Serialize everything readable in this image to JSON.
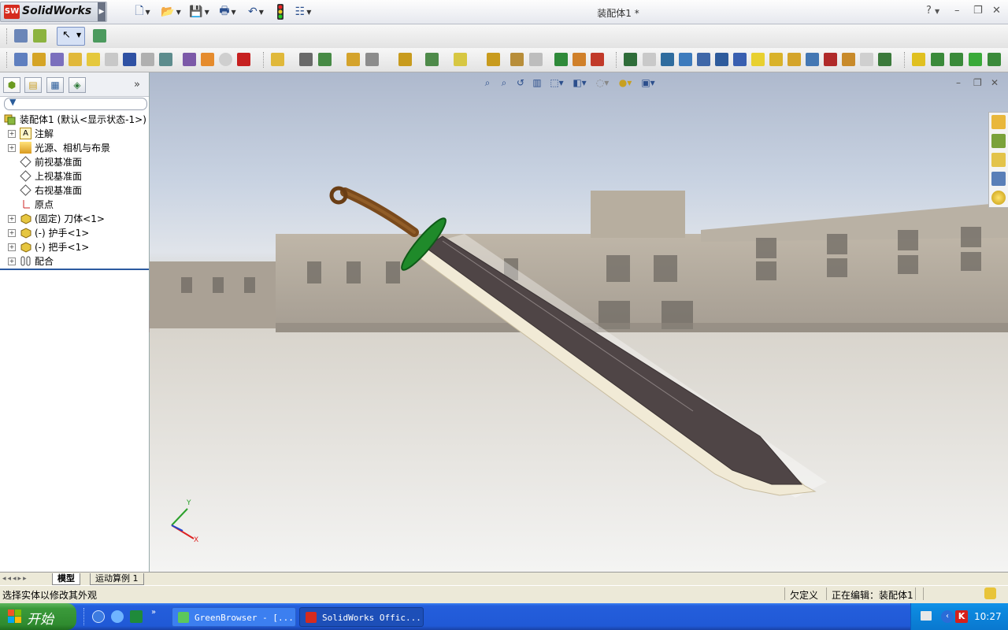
{
  "app": {
    "logo_text": "SolidWorks",
    "doc_title": "装配体1 *",
    "help_label": "?"
  },
  "tree": {
    "root": "装配体1 (默认<显示状态-1>)",
    "items": [
      {
        "label": "注解",
        "expand": "+"
      },
      {
        "label": "光源、相机与布景",
        "expand": "+"
      },
      {
        "label": "前视基准面",
        "expand": ""
      },
      {
        "label": "上视基准面",
        "expand": ""
      },
      {
        "label": "右视基准面",
        "expand": ""
      },
      {
        "label": "原点",
        "expand": ""
      },
      {
        "label": "(固定) 刀体<1>",
        "expand": "+"
      },
      {
        "label": "(-) 护手<1>",
        "expand": "+"
      },
      {
        "label": "(-) 把手<1>",
        "expand": "+"
      },
      {
        "label": "配合",
        "expand": "+"
      }
    ]
  },
  "bottom_tabs": {
    "model": "模型",
    "motion": "运动算例 1"
  },
  "status": {
    "hint": "选择实体以修改其外观",
    "state": "欠定义",
    "editing": "正在编辑：装配体1"
  },
  "triad": {
    "x": "X",
    "y": "Y"
  },
  "taskbar": {
    "start": "开始",
    "tasks": [
      "GreenBrowser - [...",
      "SolidWorks Offic..."
    ],
    "clock": "10:27"
  },
  "colors": {
    "sw_red": "#d52b1e",
    "blade": "#4f4546",
    "guard": "#1f8a2a",
    "handle": "#7a4a1c"
  }
}
